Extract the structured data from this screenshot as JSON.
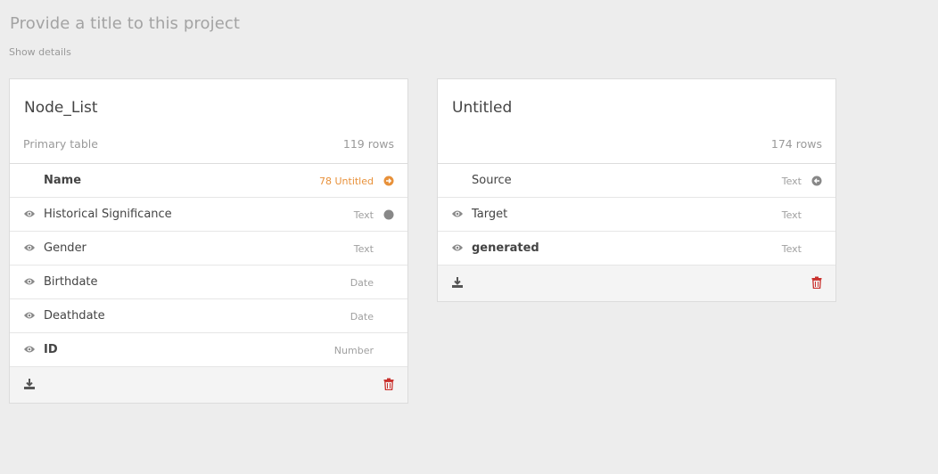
{
  "project": {
    "title_placeholder": "Provide a title to this project",
    "show_details": "Show details"
  },
  "colors": {
    "background": "#ededed",
    "link_orange": "#e8913a",
    "trash_red": "#c9302c",
    "gray_dot": "#888888"
  },
  "tables": [
    {
      "title": "Node_List",
      "subtitle": "Primary table",
      "rows_count": "119 rows",
      "fields": [
        {
          "name": "Name",
          "type": "78 Untitled",
          "bold": true,
          "eye": false,
          "icon": "arrow-right-circle-icon"
        },
        {
          "name": "Historical Significance",
          "type": "Text",
          "bold": false,
          "eye": true,
          "icon": "dot-icon"
        },
        {
          "name": "Gender",
          "type": "Text",
          "bold": false,
          "eye": true,
          "icon": ""
        },
        {
          "name": "Birthdate",
          "type": "Date",
          "bold": false,
          "eye": true,
          "icon": ""
        },
        {
          "name": "Deathdate",
          "type": "Date",
          "bold": false,
          "eye": true,
          "icon": ""
        },
        {
          "name": "ID",
          "type": "Number",
          "bold": true,
          "eye": true,
          "icon": ""
        }
      ]
    },
    {
      "title": "Untitled",
      "subtitle": "",
      "rows_count": "174 rows",
      "fields": [
        {
          "name": "Source",
          "type": "Text",
          "bold": false,
          "eye": false,
          "icon": "arrow-left-circle-icon"
        },
        {
          "name": "Target",
          "type": "Text",
          "bold": false,
          "eye": true,
          "icon": ""
        },
        {
          "name": "generated",
          "type": "Text",
          "bold": true,
          "eye": true,
          "icon": ""
        }
      ]
    }
  ]
}
